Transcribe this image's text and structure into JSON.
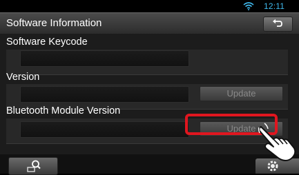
{
  "status_bar": {
    "time": "12:11",
    "wifi_icon": "wifi-icon",
    "accent_color": "#3fb8ec"
  },
  "header": {
    "title": "Software Information",
    "back_icon": "return-arrow-icon"
  },
  "sections": [
    {
      "label": "Software Keycode",
      "value": "",
      "has_update": false
    },
    {
      "label": "Version",
      "value": "",
      "update_label": "Update",
      "has_update": true
    },
    {
      "label": "Bluetooth Module Version",
      "value": "",
      "update_label": "Update",
      "has_update": true
    }
  ],
  "highlight": {
    "target": "bluetooth-update-button",
    "color": "#e0161f"
  },
  "bottom_bar": {
    "left_icon": "search-icon",
    "right_icon": "settings-icon"
  },
  "pointer_icon": "hand-pointer-icon"
}
